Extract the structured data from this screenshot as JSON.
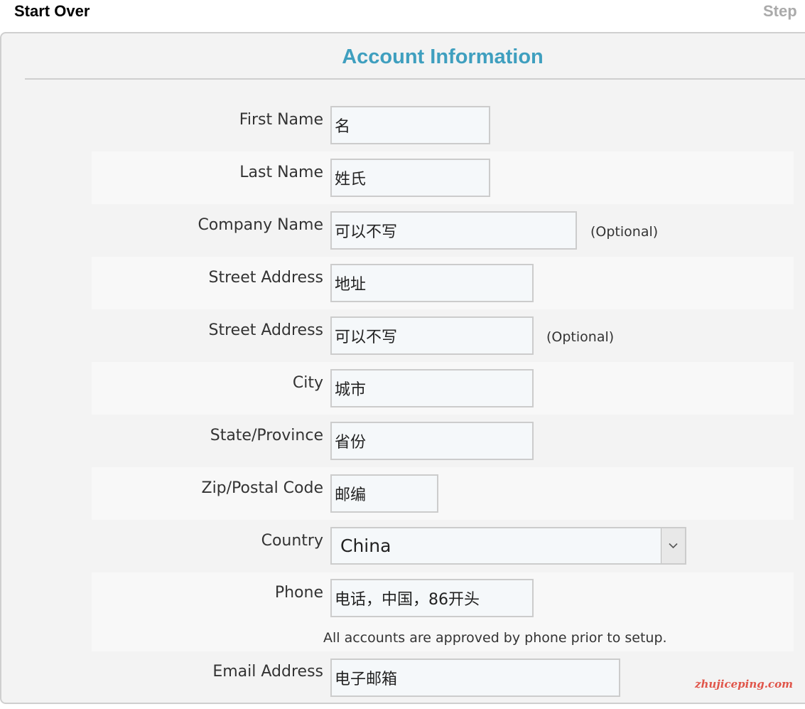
{
  "header": {
    "start_over_label": "Start Over",
    "step_label": "Step"
  },
  "form": {
    "title": "Account Information",
    "first_name": {
      "label": "First Name",
      "value": "名"
    },
    "last_name": {
      "label": "Last Name",
      "value": "姓氏"
    },
    "company_name": {
      "label": "Company Name",
      "value": "可以不写",
      "note": "(Optional)"
    },
    "street_address_1": {
      "label": "Street Address",
      "value": "地址"
    },
    "street_address_2": {
      "label": "Street Address",
      "value": "可以不写",
      "note": "(Optional)"
    },
    "city": {
      "label": "City",
      "value": "城市"
    },
    "state_province": {
      "label": "State/Province",
      "value": "省份"
    },
    "zip_postal_code": {
      "label": "Zip/Postal Code",
      "value": "邮编"
    },
    "country": {
      "label": "Country",
      "selected": "China"
    },
    "phone": {
      "label": "Phone",
      "value": "电话，中国，86开头",
      "note": "All accounts are approved by phone prior to setup."
    },
    "email_address": {
      "label": "Email Address",
      "value": "电子邮箱"
    }
  },
  "watermark": "zhujiceping.com",
  "colors": {
    "title": "#3f9fbf",
    "panel_background": "#f3f3f3",
    "row_alt_background": "#f8f8f8",
    "input_background": "#f5f8fa",
    "watermark": "#e0554a"
  }
}
